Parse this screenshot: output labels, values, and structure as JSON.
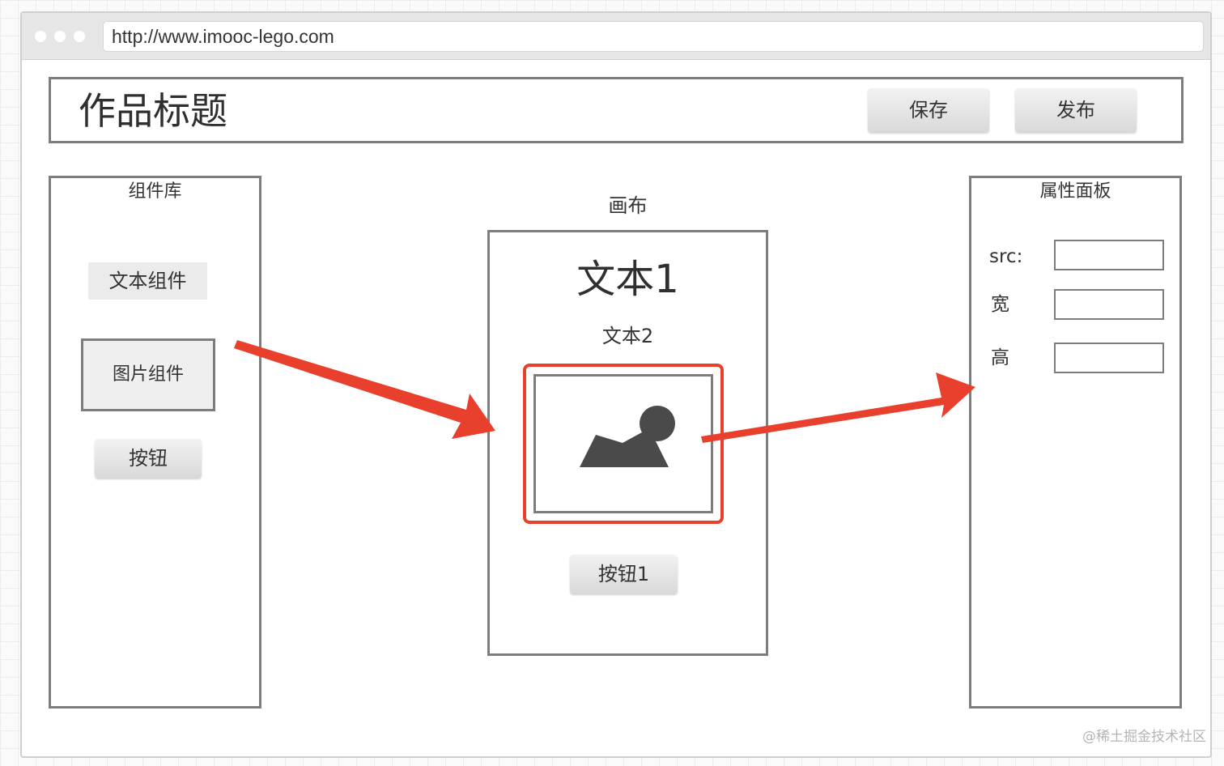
{
  "browser": {
    "url": "http://www.imooc-lego.com"
  },
  "header": {
    "title": "作品标题",
    "save_label": "保存",
    "publish_label": "发布"
  },
  "component_library": {
    "title": "组件库",
    "items": [
      {
        "label": "文本组件"
      },
      {
        "label": "图片组件"
      },
      {
        "label": "按钮"
      }
    ]
  },
  "canvas": {
    "title": "画布",
    "text1": "文本1",
    "text2": "文本2",
    "button_label": "按钮1"
  },
  "property_panel": {
    "title": "属性面板",
    "fields": [
      {
        "label": "src:",
        "value": ""
      },
      {
        "label": "宽",
        "value": ""
      },
      {
        "label": "高",
        "value": ""
      }
    ]
  },
  "watermark": "@稀土掘金技术社区",
  "colors": {
    "selection": "#e8402c",
    "arrow": "#e8402c",
    "border": "#7d7d7d"
  }
}
